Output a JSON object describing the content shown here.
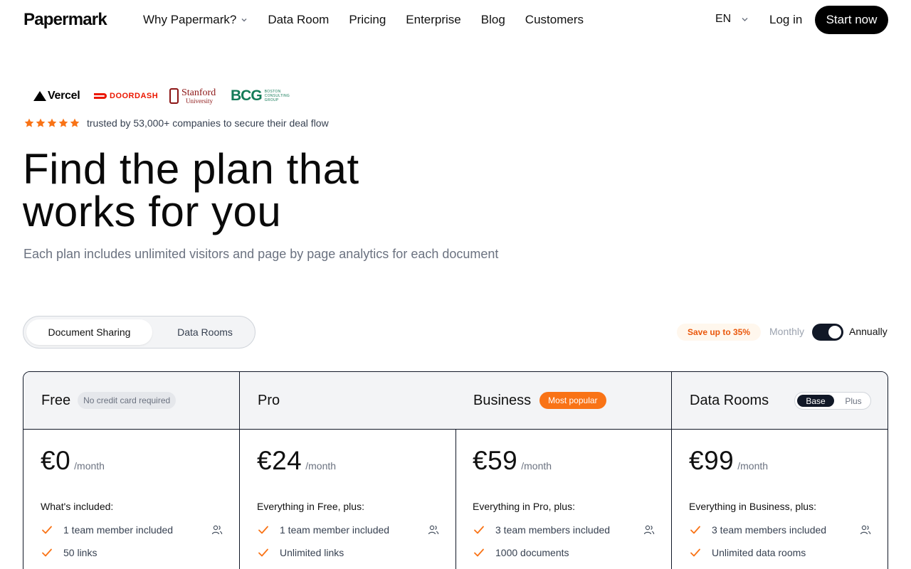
{
  "nav": {
    "logo": "Papermark",
    "links": [
      "Why Papermark?",
      "Data Room",
      "Pricing",
      "Enterprise",
      "Blog",
      "Customers"
    ],
    "language": "EN",
    "login": "Log in",
    "cta": "Start now"
  },
  "logos": {
    "vercel": "Vercel",
    "doordash": "DOORDASH",
    "stanford_1": "Stanford",
    "stanford_2": "University",
    "bcg": "BCG",
    "bcg_small_1": "BOSTON",
    "bcg_small_2": "CONSULTING",
    "bcg_small_3": "GROUP"
  },
  "trust": {
    "rating_stars": 5,
    "text": "trusted by 53,000+ companies to secure their deal flow",
    "star_color": "#f97316"
  },
  "hero": {
    "title_line1": "Find the plan that",
    "title_line2": "works for you",
    "subtitle": "Each plan includes unlimited visitors and page by page analytics for each document"
  },
  "tabs": {
    "document_sharing": "Document Sharing",
    "data_rooms": "Data Rooms",
    "active": "Document Sharing"
  },
  "billing": {
    "save_badge": "Save up to 35%",
    "monthly": "Monthly",
    "annually": "Annually",
    "selected": "Annually"
  },
  "plans": [
    {
      "name": "Free",
      "badge": "No credit card required",
      "price": "€0",
      "period": "/month",
      "included_heading": "What's included:",
      "features": [
        "1 team member included",
        "50 links"
      ]
    },
    {
      "name": "Pro",
      "price": "€24",
      "period": "/month",
      "included_heading": "Everything in Free, plus:",
      "features": [
        "1 team member included",
        "Unlimited links"
      ]
    },
    {
      "name": "Business",
      "badge": "Most popular",
      "price": "€59",
      "period": "/month",
      "included_heading": "Everything in Pro, plus:",
      "features": [
        "3 team members included",
        "1000 documents"
      ]
    },
    {
      "name": "Data Rooms",
      "segment_options": [
        "Base",
        "Plus"
      ],
      "segment_selected": "Base",
      "price": "€99",
      "period": "/month",
      "included_heading": "Everything in Business, plus:",
      "features": [
        "3 team members included",
        "Unlimited data rooms"
      ]
    }
  ],
  "colors": {
    "accent": "#f97316",
    "dark": "#111827",
    "check": "#f97316"
  }
}
